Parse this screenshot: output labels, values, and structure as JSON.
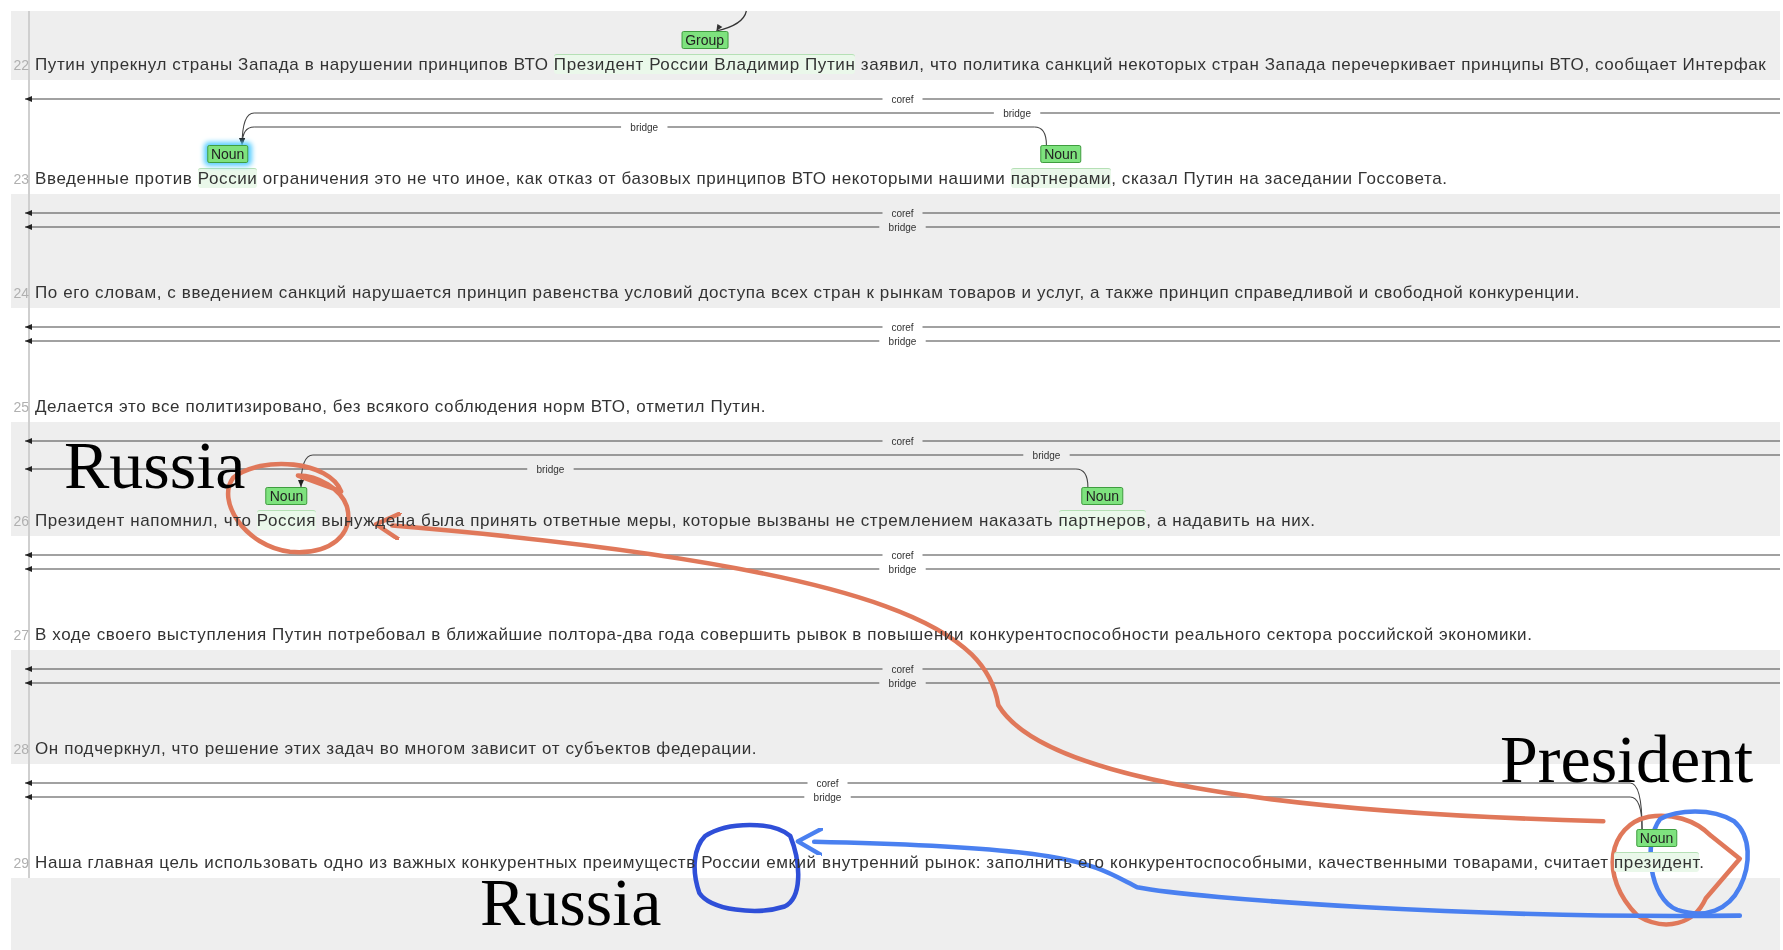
{
  "rows": [
    {
      "number": "22",
      "segments": [
        {
          "text": "Путин упрекнул страны Запада в нарушении принципов ВТО "
        },
        {
          "text": "Президент России Владимир Путин",
          "span": {
            "label": "Group",
            "highlighted": false
          }
        },
        {
          "text": " заявил, что политика санкций некоторых стран Запада перечеркивает принципы ВТО, сообщает Интерфак"
        }
      ],
      "arcs": [
        {
          "from": {
            "kind": "top"
          },
          "to": {
            "kind": "first-span"
          }
        }
      ]
    },
    {
      "number": "23",
      "segments": [
        {
          "text": "Введенные против "
        },
        {
          "text": "России",
          "span": {
            "label": "Noun",
            "highlighted": true
          }
        },
        {
          "text": " ограничения это не что иное, как отказ от базовых принципов ВТО некоторыми нашими "
        },
        {
          "text": "партнерами",
          "span": {
            "label": "Noun",
            "highlighted": false
          }
        },
        {
          "text": ", сказал Путин на заседании Госсовета."
        }
      ],
      "arcs": [
        {
          "label": "coref",
          "from": {
            "kind": "right-edge"
          },
          "to": {
            "kind": "left-edge"
          }
        },
        {
          "label": "bridge",
          "from": {
            "kind": "right-edge"
          },
          "to": {
            "kind": "first-span"
          }
        },
        {
          "label": "bridge",
          "from": {
            "kind": "second-span"
          },
          "to": {
            "kind": "first-span"
          }
        }
      ]
    },
    {
      "number": "24",
      "segments": [
        {
          "text": "По его словам, с введением санкций нарушается принцип равенства условий доступа всех стран к рынкам товаров и услуг, а также принцип справедливой и свободной конкуренции."
        }
      ],
      "arcs": [
        {
          "label": "coref",
          "from": {
            "kind": "right-edge"
          },
          "to": {
            "kind": "left-edge"
          }
        },
        {
          "label": "bridge",
          "from": {
            "kind": "right-edge"
          },
          "to": {
            "kind": "left-edge"
          }
        }
      ]
    },
    {
      "number": "25",
      "segments": [
        {
          "text": "Делается это все политизировано, без всякого соблюдения норм ВТО, отметил Путин."
        }
      ],
      "arcs": [
        {
          "label": "coref",
          "from": {
            "kind": "right-edge"
          },
          "to": {
            "kind": "left-edge"
          }
        },
        {
          "label": "bridge",
          "from": {
            "kind": "right-edge"
          },
          "to": {
            "kind": "left-edge"
          }
        }
      ]
    },
    {
      "number": "26",
      "segments": [
        {
          "text": "Президент напомнил, что "
        },
        {
          "text": "Россия",
          "span": {
            "label": "Noun",
            "highlighted": false
          }
        },
        {
          "text": " вынуждена была принять ответные меры, которые вызваны не стремлением наказать "
        },
        {
          "text": "партнеров",
          "span": {
            "label": "Noun",
            "highlighted": false
          }
        },
        {
          "text": ", а надавить на них."
        }
      ],
      "arcs": [
        {
          "label": "coref",
          "from": {
            "kind": "right-edge"
          },
          "to": {
            "kind": "left-edge"
          }
        },
        {
          "label": "bridge",
          "from": {
            "kind": "right-edge"
          },
          "to": {
            "kind": "first-span"
          }
        },
        {
          "label": "bridge",
          "from": {
            "kind": "second-span"
          },
          "to": {
            "kind": "left-edge"
          }
        }
      ]
    },
    {
      "number": "27",
      "segments": [
        {
          "text": "В ходе своего выступления Путин потребовал в ближайшие полтора-два года совершить рывок в повышении конкурентоспособности реального сектора российской экономики."
        }
      ],
      "arcs": [
        {
          "label": "coref",
          "from": {
            "kind": "right-edge"
          },
          "to": {
            "kind": "left-edge"
          }
        },
        {
          "label": "bridge",
          "from": {
            "kind": "right-edge"
          },
          "to": {
            "kind": "left-edge"
          }
        }
      ]
    },
    {
      "number": "28",
      "segments": [
        {
          "text": "Он подчеркнул, что решение этих задач во многом зависит от субъектов федерации."
        }
      ],
      "arcs": [
        {
          "label": "coref",
          "from": {
            "kind": "right-edge"
          },
          "to": {
            "kind": "left-edge"
          }
        },
        {
          "label": "bridge",
          "from": {
            "kind": "right-edge"
          },
          "to": {
            "kind": "left-edge"
          }
        }
      ]
    },
    {
      "number": "29",
      "segments": [
        {
          "text": "Наша главная цель использовать одно из важных конкурентных преимуществ России емкий внутренний рынок: заполнить его конкурентоспособными, качественными товарами, считает "
        },
        {
          "text": "президент",
          "span": {
            "label": "Noun",
            "highlighted": false
          }
        },
        {
          "text": "."
        }
      ],
      "arcs": [
        {
          "label": "coref",
          "from": {
            "kind": "first-span"
          },
          "to": {
            "kind": "left-edge"
          }
        },
        {
          "label": "bridge",
          "from": {
            "kind": "first-span"
          },
          "to": {
            "kind": "left-edge"
          }
        }
      ]
    }
  ],
  "callouts": [
    {
      "text": "Russia"
    },
    {
      "text": "Russia"
    },
    {
      "text": "President"
    }
  ],
  "marks": [
    {
      "kind": "circle",
      "color": "#e0785a"
    },
    {
      "kind": "arrow",
      "color": "#e0785a"
    },
    {
      "kind": "circle",
      "color": "#e0785a"
    },
    {
      "kind": "circle",
      "color": "#4a80f0"
    },
    {
      "kind": "arrow",
      "color": "#4a80f0"
    },
    {
      "kind": "circle",
      "color": "#2f4fd8"
    }
  ]
}
